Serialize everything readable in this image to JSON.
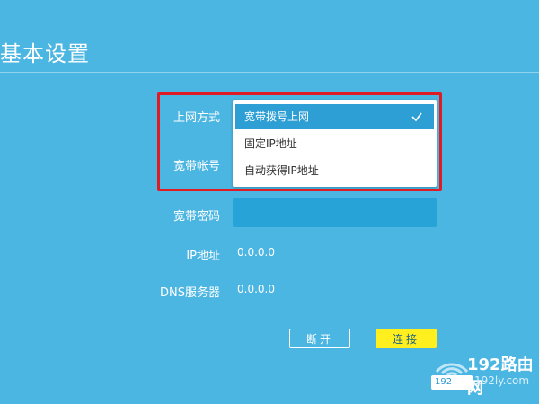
{
  "page": {
    "title": "基本设置"
  },
  "form": {
    "connection_type_label": "上网方式",
    "account_label": "宽带帐号",
    "password_label": "宽带密码",
    "ip_label": "IP地址",
    "ip_value": "0.0.0.0",
    "dns_label": "DNS服务器",
    "dns_value": "0.0.0.0"
  },
  "dropdown": {
    "options": [
      {
        "label": "宽带拨号上网",
        "selected": true
      },
      {
        "label": "固定IP地址",
        "selected": false
      },
      {
        "label": "自动获得IP地址",
        "selected": false
      }
    ]
  },
  "buttons": {
    "disconnect_label": "断开",
    "connect_label": "连接"
  },
  "watermark": {
    "brand": "192路由网",
    "badge": "192",
    "domain": "192ly.com"
  },
  "colors": {
    "background": "#4cb6e2",
    "input": "#27a3d8",
    "selected_option": "#2e9fd5",
    "highlight_border": "#e01b24",
    "connect_button": "#ffef1e"
  },
  "icons": {
    "check": "check-icon",
    "signal": "wifi-signal-icon"
  }
}
